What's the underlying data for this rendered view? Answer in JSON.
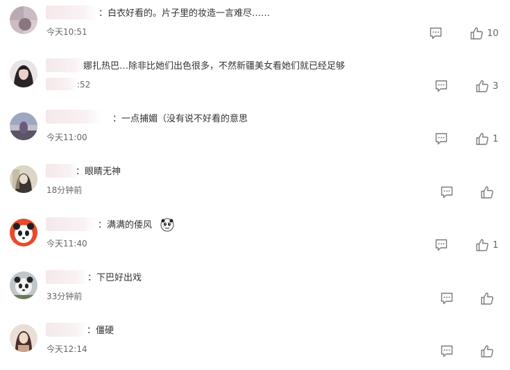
{
  "colors": {
    "text": "#333333",
    "meta": "#666666",
    "icon": "#7a7a7a",
    "redaction": "#f6ecee"
  },
  "comments": [
    {
      "text": "：白衣好看的。片子里的妆造一言难尽……",
      "time": "今天10:51",
      "likes": "10",
      "reply_icon": "comment-icon",
      "like_icon": "thumbs-up-icon"
    },
    {
      "text": "娜扎热巴…除非比她们出色很多，不然新疆美女看她们就已经足够",
      "time": ":52",
      "likes": "3",
      "reply_icon": "comment-icon",
      "like_icon": "thumbs-up-icon"
    },
    {
      "text": "：一点捕媚（没有说不好看的意思",
      "time": "今天11:00",
      "likes": "1",
      "reply_icon": "comment-icon",
      "like_icon": "thumbs-up-icon"
    },
    {
      "text": "：眼睛无神",
      "time": "18分钟前",
      "likes": "",
      "reply_icon": "comment-icon",
      "like_icon": "thumbs-up-icon"
    },
    {
      "text": "：满满的倭风",
      "time": "今天11:40",
      "likes": "1",
      "emoji": "panda-emoji",
      "reply_icon": "comment-icon",
      "like_icon": "thumbs-up-icon"
    },
    {
      "text": "：下巴好出戏",
      "time": "33分钟前",
      "likes": "",
      "reply_icon": "comment-icon",
      "like_icon": "thumbs-up-icon"
    },
    {
      "text": "：僵硬",
      "time": "今天12:14",
      "likes": "",
      "reply_icon": "comment-icon",
      "like_icon": "thumbs-up-icon"
    }
  ]
}
